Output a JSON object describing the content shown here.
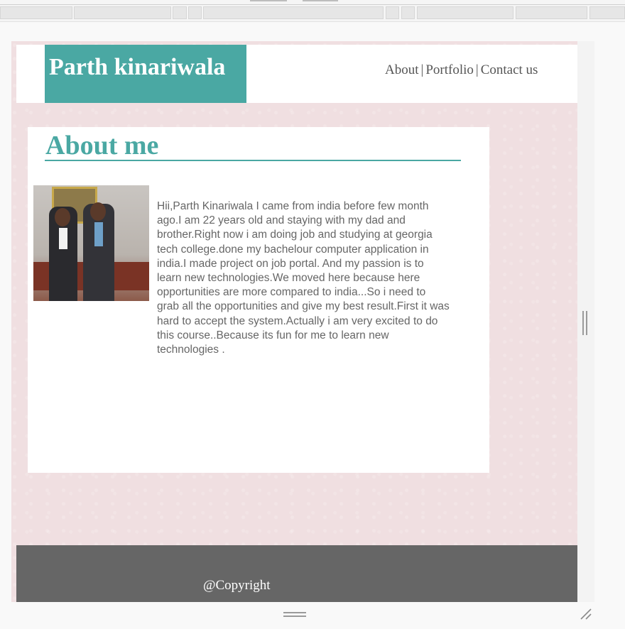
{
  "header": {
    "logo": "Parth kinariwala",
    "nav": [
      {
        "label": "About"
      },
      {
        "label": "Portfolio"
      },
      {
        "label": "Contact us"
      }
    ],
    "separator": "|"
  },
  "main": {
    "title": "About me",
    "bio": "Hii,Parth Kinariwala I came from india before few month ago.I am 22 years old and staying with my dad and brother.Right now i am doing job and studying at georgia tech college.done my bachelour computer application in india.I made project on job portal. And my passion is to learn new technologies.We moved here because here opportunities are more compared to india...So i need to grab all the opportunities and give my best result.First it was hard to accept the system.Actually i am very excited to do this course..Because its fun for me to learn new technologies ."
  },
  "footer": {
    "copyright": "@Copyright"
  },
  "colors": {
    "accent": "#4aa8a3",
    "page_bg": "#f0dfe1",
    "footer_bg": "#666666",
    "text": "#666666"
  },
  "icons": {
    "vertical_resize": "vertical-resize-handle-icon",
    "horizontal_resize": "horizontal-resize-handle-icon",
    "corner_resize": "corner-resize-grip-icon"
  }
}
